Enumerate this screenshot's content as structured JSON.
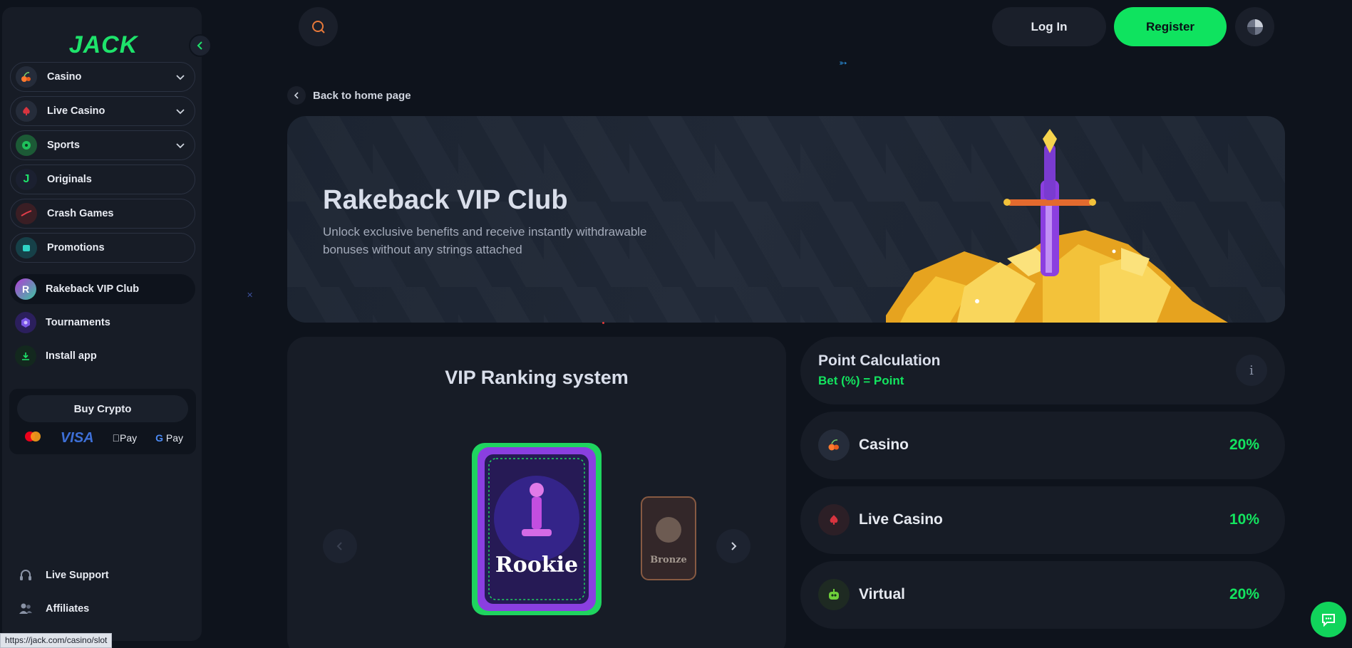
{
  "brand": {
    "logo_text": "JACK",
    "accent": "#0fe35f"
  },
  "sidebar": {
    "categories": [
      {
        "label": "Casino",
        "icon": "cherry-icon",
        "expandable": true
      },
      {
        "label": "Live Casino",
        "icon": "spade-icon",
        "expandable": true
      },
      {
        "label": "Sports",
        "icon": "clover-ball-icon",
        "expandable": true
      },
      {
        "label": "Originals",
        "icon": "j-logo-icon",
        "expandable": false
      },
      {
        "label": "Crash Games",
        "icon": "rocket-icon",
        "expandable": false
      },
      {
        "label": "Promotions",
        "icon": "gift-icon",
        "expandable": false
      }
    ],
    "links": [
      {
        "label": "Rakeback VIP Club",
        "icon": "vip-badge-icon",
        "active": true
      },
      {
        "label": "Tournaments",
        "icon": "trophy-hex-icon",
        "active": false
      },
      {
        "label": "Install app",
        "icon": "download-icon",
        "active": false
      }
    ],
    "buy_crypto": {
      "label": "Buy Crypto",
      "payment_methods": [
        "Mastercard",
        "VISA",
        "Pay",
        "Pay"
      ]
    },
    "footer_links": [
      {
        "label": "Live Support",
        "icon": "headset-icon"
      },
      {
        "label": "Affiliates",
        "icon": "users-icon"
      }
    ]
  },
  "header": {
    "login_label": "Log In",
    "register_label": "Register"
  },
  "back_link": "Back to home page",
  "hero": {
    "title": "Rakeback VIP Club",
    "subtitle": "Unlock exclusive benefits and receive instantly withdrawable bonuses without any strings attached"
  },
  "vip": {
    "title": "VIP Ranking system",
    "cards": [
      {
        "label": "Rookie",
        "current": true
      },
      {
        "label": "Bronze",
        "current": false
      }
    ]
  },
  "points": {
    "title": "Point Calculation",
    "formula": "Bet (%) = Point",
    "rates": [
      {
        "label": "Casino",
        "value": "20%",
        "icon": "cherry-icon"
      },
      {
        "label": "Live Casino",
        "value": "10%",
        "icon": "spade-icon"
      },
      {
        "label": "Virtual",
        "value": "20%",
        "icon": "robot-icon"
      }
    ]
  },
  "status_bar_url": "https://jack.com/casino/slot"
}
